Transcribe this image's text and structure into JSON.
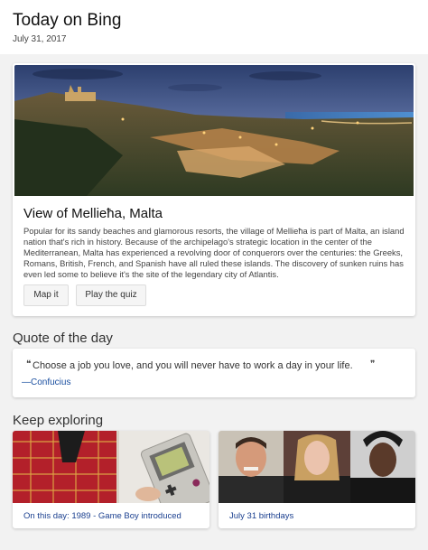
{
  "header": {
    "title": "Today on Bing",
    "date": "July 31, 2017"
  },
  "hero": {
    "title": "View of Mellieħa, Malta",
    "description": "Popular for its sandy beaches and glamorous resorts, the village of Mellieħa is part of Malta, an island nation that's rich in history. Because of the archipelago's strategic location in the center of the Mediterranean, Malta has experienced a revolving door of conquerors over the centuries: the Greeks, Romans, British, French, and Spanish have all ruled these islands. The discovery of sunken ruins has even led some to believe it's the site of the legendary city of Atlantis.",
    "map_label": "Map it",
    "quiz_label": "Play the quiz"
  },
  "quote": {
    "section_title": "Quote of the day",
    "text": "Choose a job you love, and you will never have to work a day in your life.",
    "author": "—Confucius"
  },
  "explore": {
    "section_title": "Keep exploring",
    "tiles": [
      {
        "caption": "On this day: 1989 - Game Boy introduced"
      },
      {
        "caption": "July 31 birthdays"
      }
    ]
  }
}
